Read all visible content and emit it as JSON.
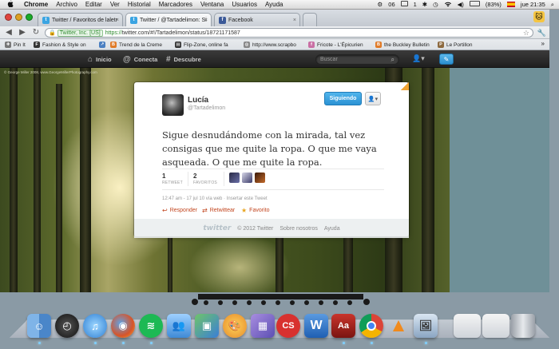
{
  "menubar": {
    "apple": "",
    "items": [
      "Chrome",
      "Archivo",
      "Editar",
      "Ver",
      "Historial",
      "Marcadores",
      "Ventana",
      "Usuarios",
      "Ayuda"
    ],
    "status": {
      "wifi_badge": "06",
      "count": "1",
      "battery": "(83%)",
      "clock": "jue 21:35"
    }
  },
  "browser": {
    "tabs": [
      {
        "label": "Twitter / Favoritos de laletr",
        "active": false
      },
      {
        "label": "Twitter / @Tartadelimon: Si",
        "active": true
      },
      {
        "label": "Facebook",
        "active": false
      }
    ],
    "tab_close": "×",
    "omnibox": {
      "ev_label": "Twitter, Inc. [US]",
      "url_scheme": "https://",
      "url_rest": "twitter.com/#!/Tartadelimon/status/18721171587"
    },
    "bookmarks": [
      "Pin It",
      "Fashion & Style on",
      "Trend de la Creme",
      "Flip-Zone, online fa",
      "http://www.scrapbo",
      "Fricote - L'Épicurien",
      "the Buckley Bulletin",
      "Le Portillon"
    ]
  },
  "twitter": {
    "nav": {
      "home": "Inicio",
      "connect": "Conecta",
      "discover": "Descubre"
    },
    "search": {
      "placeholder": "Buscar"
    },
    "photo_credit": "© George Miller 2008, www.GeorgeMillerPhotography.com",
    "tweet": {
      "display_name": "Lucía",
      "screen_name": "@Tartadelimon",
      "follow_label": "Siguiendo",
      "text": "Sigue desnudándome con la mirada, tal vez consigas que me quite la ropa. O que me vaya asqueada. O que me quite la ropa.",
      "retweets": {
        "count": "1",
        "label": "RETWEET"
      },
      "favorites": {
        "count": "2",
        "label": "FAVORITOS"
      },
      "timestamp": "12:47 am - 17 jul 10 vía web · Insertar este Tweet",
      "actions": {
        "reply": "Responder",
        "retweet": "Retwittear",
        "favorite": "Favorito"
      }
    },
    "footer": {
      "logo": "twitter",
      "copyright": "© 2012 Twitter",
      "about": "Sobre nosotros",
      "help": "Ayuda"
    }
  },
  "colors": {
    "twitter_blue": "#2b92d4",
    "reply_orange": "#c2461f",
    "favorite_gold": "#e8a521",
    "topbar_dark": "#262626"
  }
}
